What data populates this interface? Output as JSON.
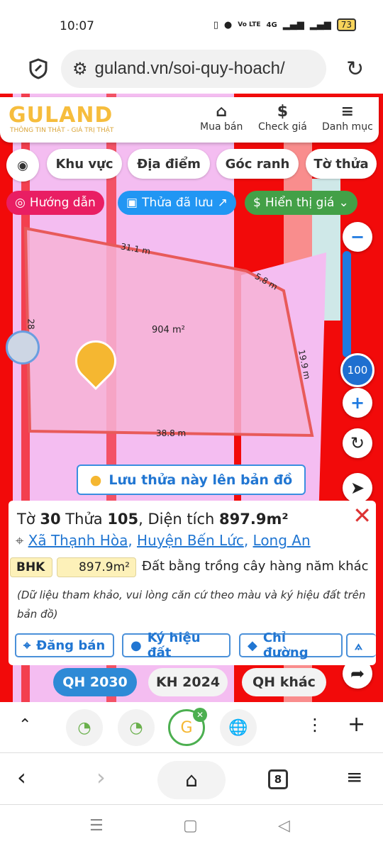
{
  "status": {
    "time": "10:07",
    "battery": "73",
    "network": "4G",
    "volte": "Vo LTE"
  },
  "browser": {
    "url": "guland.vn/soi-quy-hoach/",
    "tab_count": "8"
  },
  "header": {
    "logo": "GULAND",
    "slogan": "THÔNG TIN THẬT - GIÁ TRỊ THẬT",
    "nav": [
      {
        "label": "Mua bán",
        "icon": "building-icon"
      },
      {
        "label": "Check giá",
        "icon": "dollar-icon"
      },
      {
        "label": "Danh mục",
        "icon": "menu-icon"
      }
    ]
  },
  "filters": [
    "Khu vực",
    "Địa điểm",
    "Góc ranh",
    "Tờ thửa"
  ],
  "actions": {
    "guide": "Hướng dẫn",
    "saved": "Thửa đã lưu",
    "price": "Hiển thị giá"
  },
  "colors": {
    "guide": "#e91e63",
    "saved": "#2196f3",
    "price": "#43a047",
    "zone": "#f20a0a",
    "parcel": "#e85a5a"
  },
  "map": {
    "edges": [
      "31.1 m",
      "5.8 m",
      "19.9 m",
      "38.8 m",
      "28"
    ],
    "area": "904 m²",
    "zoom": "100",
    "save_btn": "Lưu thửa này lên bản đồ"
  },
  "card": {
    "to_label": "Tờ",
    "to": "30",
    "thua_label": "Thửa",
    "thua": "105",
    "dt_label": ", Diện tích",
    "area": "897.9m²",
    "commune": "Xã Thạnh Hòa",
    "district": "Huyện Bến Lức",
    "province": "Long An",
    "code": "BHK",
    "code_area": "897.9m²",
    "land_type": "Đất bằng trồng cây hàng năm khác",
    "note": "(Dữ liệu tham khảo, vui lòng căn cứ theo màu và ký hiệu đất trên bản đồ)",
    "buttons": [
      "Đăng bán",
      "Ký hiệu đất",
      "Chỉ đường"
    ]
  },
  "plans": [
    "QH 2030",
    "KH 2024",
    "QH khác"
  ]
}
